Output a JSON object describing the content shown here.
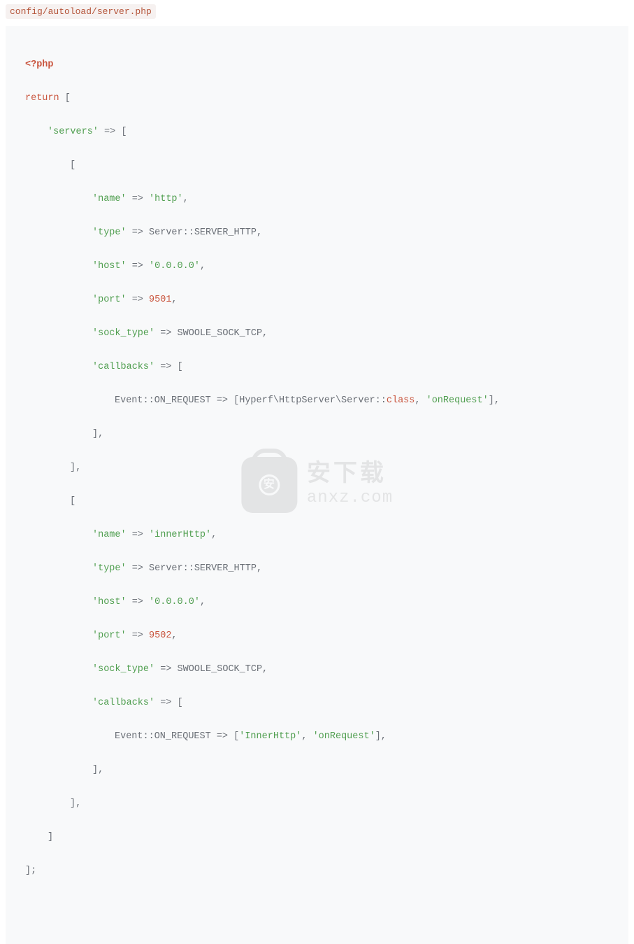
{
  "file_path": "config/autoload/server.php",
  "code": {
    "php_open": "<?php",
    "return_kw": "return",
    "open_bracket": " [",
    "servers_key": "'servers'",
    "arrow": " => ",
    "arrow_spaced": " => ",
    "open_sub_bracket": "[",
    "name_key": "'name'",
    "http_val": "'http'",
    "type_key": "'type'",
    "type_val": "Server::SERVER_HTTP,",
    "host_key": "'host'",
    "host_val": "'0.0.0.0'",
    "port_key": "'port'",
    "port1": "9501",
    "sock_key": "'sock_type'",
    "sock_val": "SWOOLE_SOCK_TCP,",
    "callbacks_key": "'callbacks'",
    "event_prefix": "Event::ON_REQUEST => [Hyperf\\HttpServer\\Server::",
    "class_kw": "class",
    "comma": ", ",
    "onrequest_str": "'onRequest'",
    "close_arr": "],",
    "inner_name": "'innerHttp'",
    "port2": "9502",
    "event2_prefix": "Event::ON_REQUEST => [",
    "innerhttp_str": "'InnerHttp'",
    "final_close1": "]",
    "final_close2": "];",
    "comma_only": ",",
    "arrow_only": " => "
  },
  "watermark": {
    "badge": "安",
    "cn": "安下载",
    "en": "anxz.com"
  }
}
